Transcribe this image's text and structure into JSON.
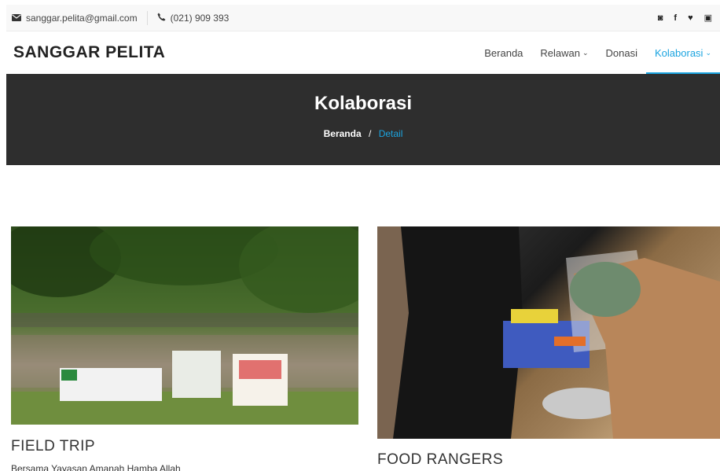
{
  "topbar": {
    "email": "sanggar.pelita@gmail.com",
    "phone": "(021) 909 393",
    "social": [
      {
        "icon": "instagram-icon",
        "glyph": "◙"
      },
      {
        "icon": "facebook-icon",
        "glyph": "f"
      },
      {
        "icon": "twitter-icon",
        "glyph": "♥"
      },
      {
        "icon": "youtube-icon",
        "glyph": "▣"
      }
    ]
  },
  "navbar": {
    "brand": "SANGGAR PELITA",
    "menu": [
      {
        "label": "Beranda",
        "dropdown": false,
        "active": false
      },
      {
        "label": "Relawan",
        "dropdown": true,
        "active": false
      },
      {
        "label": "Donasi",
        "dropdown": false,
        "active": false
      },
      {
        "label": "Kolaborasi",
        "dropdown": true,
        "active": true
      }
    ]
  },
  "hero": {
    "title": "Kolaborasi",
    "breadcrumb_home": "Beranda",
    "breadcrumb_sep": "/",
    "breadcrumb_current": "Detail"
  },
  "cards": [
    {
      "title": "FIELD TRIP",
      "description": "Bersama Yayasan Amanah Hamba Allah"
    },
    {
      "title": "FOOD RANGERS",
      "description": ""
    }
  ],
  "colors": {
    "accent": "#1ba4e0",
    "hero_bg": "#2e2e2e"
  }
}
